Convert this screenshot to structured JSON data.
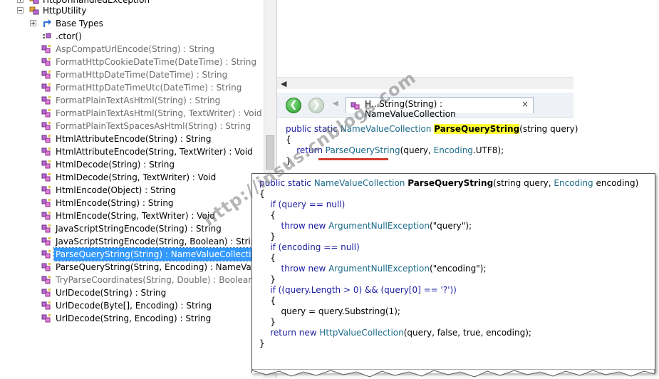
{
  "tree": {
    "top_partial": "HttpUnhandledException",
    "class_name": "HttpUtility",
    "base_types": "Base Types",
    "items": [
      {
        "label": ".ctor()",
        "gray": false,
        "icon": "constructor-icon"
      },
      {
        "label": "AspCompatUrlEncode(String) : String",
        "gray": true,
        "icon": "method-icon"
      },
      {
        "label": "FormatHttpCookieDateTime(DateTime) : String",
        "gray": true,
        "icon": "method-icon"
      },
      {
        "label": "FormatHttpDateTime(DateTime) : String",
        "gray": true,
        "icon": "method-icon"
      },
      {
        "label": "FormatHttpDateTimeUtc(DateTime) : String",
        "gray": true,
        "icon": "method-icon"
      },
      {
        "label": "FormatPlainTextAsHtml(String) : String",
        "gray": true,
        "icon": "method-icon"
      },
      {
        "label": "FormatPlainTextAsHtml(String, TextWriter) : Void",
        "gray": true,
        "icon": "method-icon"
      },
      {
        "label": "FormatPlainTextSpacesAsHtml(String) : String",
        "gray": true,
        "icon": "method-icon"
      },
      {
        "label": "HtmlAttributeEncode(String) : String",
        "gray": false,
        "icon": "method-icon"
      },
      {
        "label": "HtmlAttributeEncode(String, TextWriter) : Void",
        "gray": false,
        "icon": "method-icon"
      },
      {
        "label": "HtmlDecode(String) : String",
        "gray": false,
        "icon": "method-icon"
      },
      {
        "label": "HtmlDecode(String, TextWriter) : Void",
        "gray": false,
        "icon": "method-icon"
      },
      {
        "label": "HtmlEncode(Object) : String",
        "gray": false,
        "icon": "method-icon"
      },
      {
        "label": "HtmlEncode(String) : String",
        "gray": false,
        "icon": "method-icon"
      },
      {
        "label": "HtmlEncode(String, TextWriter) : Void",
        "gray": false,
        "icon": "method-icon"
      },
      {
        "label": "JavaScriptStringEncode(String) : String",
        "gray": false,
        "icon": "method-icon"
      },
      {
        "label": "JavaScriptStringEncode(String, Boolean) : String",
        "gray": false,
        "icon": "method-icon"
      },
      {
        "label": "ParseQueryString(String) : NameValueCollection",
        "gray": false,
        "icon": "method-icon",
        "selected": true
      },
      {
        "label": "ParseQueryString(String, Encoding) : NameValueCollection",
        "gray": false,
        "icon": "method-icon"
      },
      {
        "label": "TryParseCoordinates(String, Double) : Boolean",
        "gray": true,
        "icon": "method-icon"
      },
      {
        "label": "UrlDecode(String) : String",
        "gray": false,
        "icon": "method-icon"
      },
      {
        "label": "UrlDecode(Byte[], Encoding) : String",
        "gray": false,
        "icon": "method-icon"
      },
      {
        "label": "UrlDecode(String, Encoding) : String",
        "gray": false,
        "icon": "method-icon"
      }
    ]
  },
  "navbar": {
    "tab_label": "H...String(String) : NameValueCollection",
    "close": "×"
  },
  "code1": {
    "line1_pre": "public static ",
    "line1_type": "NameValueCollection ",
    "line1_name": "ParseQueryString",
    "line1_post": "(string query)",
    "line2": "{",
    "line3_ret": "    return ",
    "line3_call": "ParseQueryString",
    "line3_mid": "(query, ",
    "line3_enc": "Encoding",
    "line3_end": ".UTF8);",
    "line4": "}"
  },
  "code2": {
    "sig_pre": "public static ",
    "sig_type": "NameValueCollection ",
    "sig_name": "ParseQueryString",
    "sig_post1": "(string query, ",
    "sig_enc": "Encoding",
    "sig_post2": " encoding)",
    "l_open": "{",
    "l_if1": "    if (query == null)",
    "l_ob1": "    {",
    "l_throw1_a": "        throw new ",
    "l_throw1_t": "ArgumentNullException",
    "l_throw1_b": "(\"query\");",
    "l_cb1": "    }",
    "l_if2": "    if (encoding == null)",
    "l_ob2": "    {",
    "l_throw2_a": "        throw new ",
    "l_throw2_t": "ArgumentNullException",
    "l_throw2_b": "(\"encoding\");",
    "l_cb2": "    }",
    "l_if3": "    if ((query.Length > 0) && (query[0] == '?'))",
    "l_ob3": "    {",
    "l_assign": "        query = query.Substring(1);",
    "l_cb3": "    }",
    "l_ret_a": "    return new ",
    "l_ret_t": "HttpValueCollection",
    "l_ret_b": "(query, false, true, encoding);",
    "l_close": "}"
  },
  "watermark": "http://insus.cnblogs.com",
  "colors": {
    "selection": "#3399ff",
    "highlight": "#ffff33",
    "keyword": "#1c1ca0",
    "type": "#1b6b8a",
    "underline": "#d23a2a"
  }
}
